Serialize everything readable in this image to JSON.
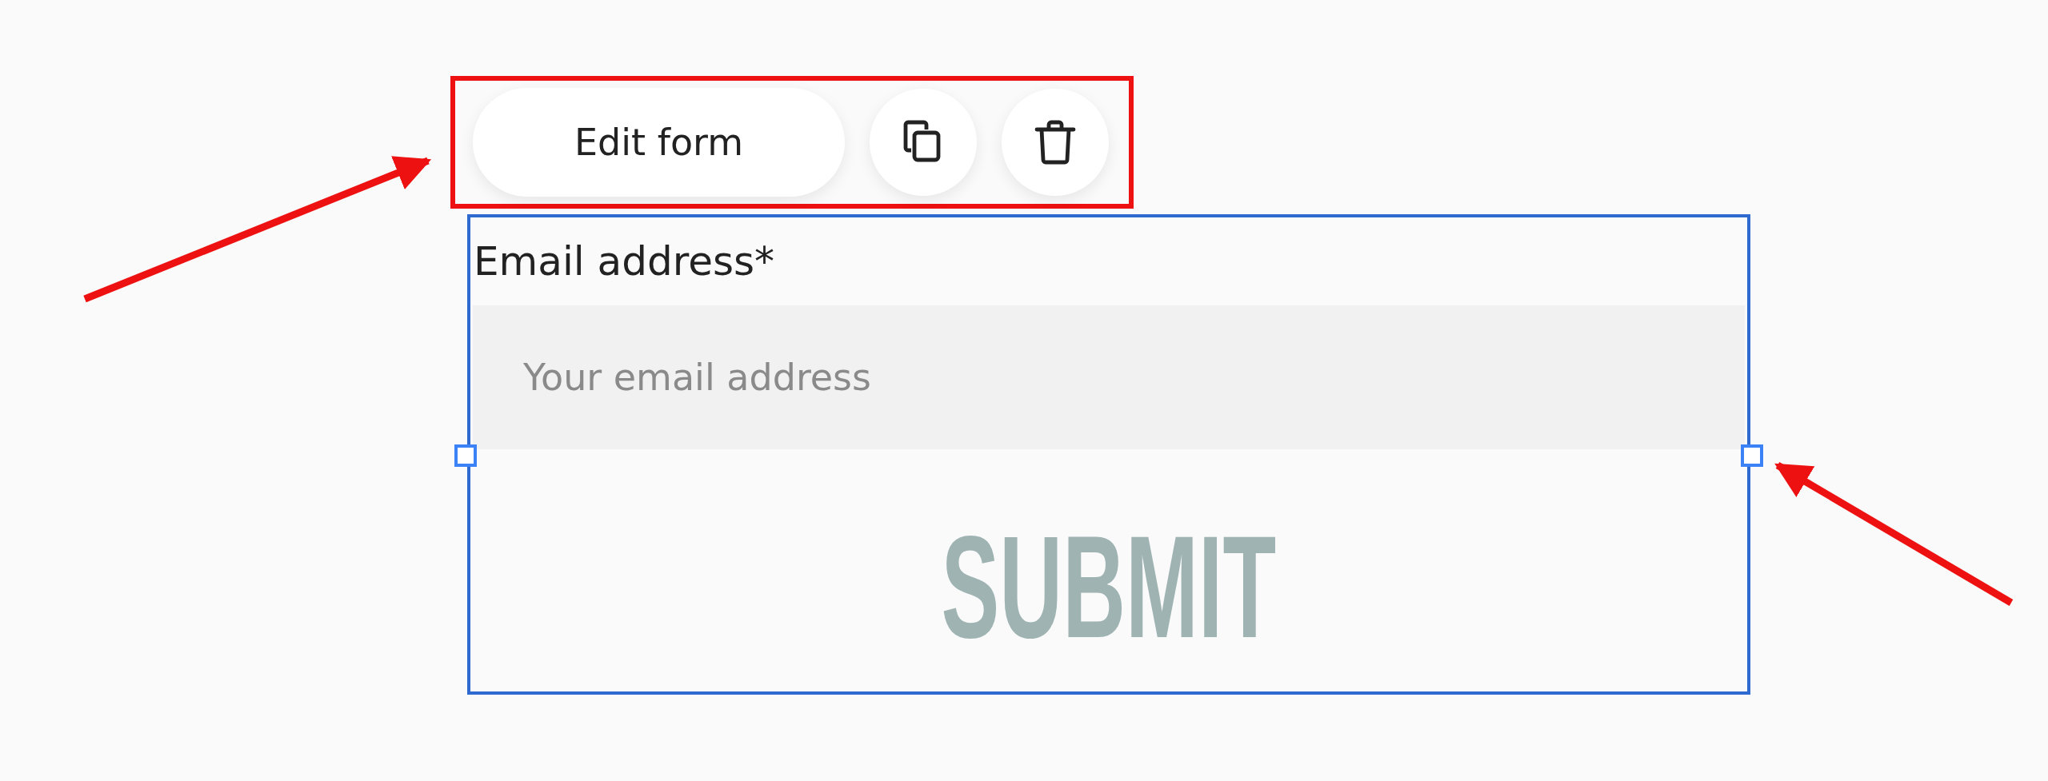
{
  "toolbar": {
    "edit_button": "Edit form"
  },
  "form": {
    "label": "Email address*",
    "email_field": {
      "placeholder": "Your email address"
    },
    "submit_button": "SUBMIT"
  }
}
